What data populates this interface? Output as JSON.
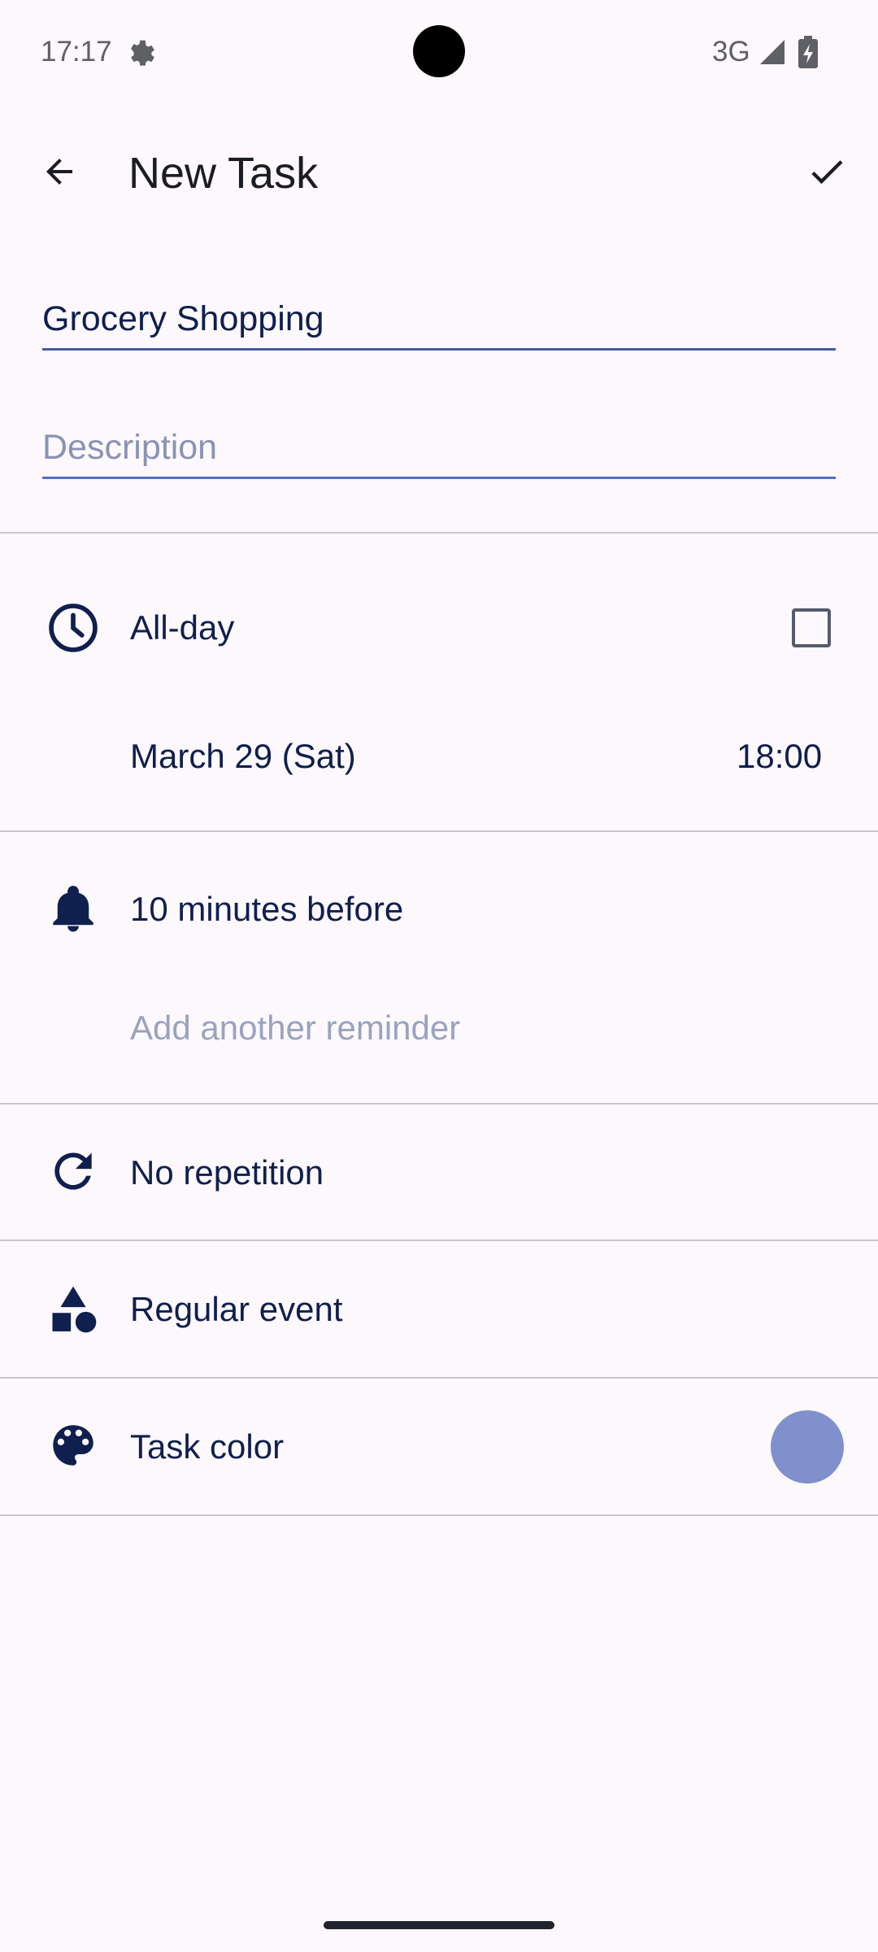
{
  "status_bar": {
    "time": "17:17",
    "network": "3G",
    "icons": [
      "gear-icon",
      "signal-icon",
      "battery-charging-icon"
    ]
  },
  "app_bar": {
    "title": "New Task",
    "back_icon": "arrow-back-icon",
    "save_icon": "check-icon"
  },
  "form": {
    "title_value": "Grocery Shopping",
    "description_placeholder": "Description"
  },
  "schedule": {
    "all_day_label": "All-day",
    "all_day_checked": false,
    "date": "March 29 (Sat)",
    "time": "18:00"
  },
  "reminders": {
    "items": [
      "10 minutes before"
    ],
    "add_label": "Add another reminder"
  },
  "repetition": {
    "label": "No repetition"
  },
  "event_type": {
    "label": "Regular event"
  },
  "task_color": {
    "label": "Task color",
    "color": "#7f90cc"
  },
  "colors": {
    "background": "#fcf8fc",
    "text_primary": "#0f1f4e",
    "underline": "#465a98",
    "muted_text": "#9aa2bf"
  }
}
